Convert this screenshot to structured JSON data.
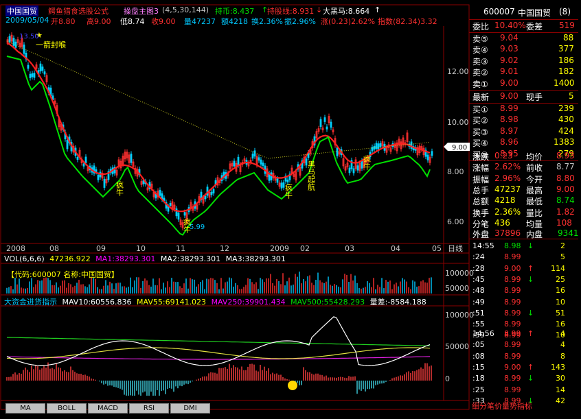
{
  "header": {
    "stock_name": "中国国贸",
    "formula_name": "鳄鱼猎食选股公式",
    "main_chart_label": "操盘主图3",
    "main_chart_params": "(4,5,30,144)",
    "hold_line": "持币:8.437",
    "hold_arrow": "↑",
    "stock_line": "持股线:8.931",
    "stock_arrow": "↓",
    "big_horse": "大黑马:8.664",
    "big_arrow": "↑"
  },
  "info": {
    "date": "2009/05/04",
    "open": "开8.80",
    "high": "高9.00",
    "low": "低8.74",
    "close": "收9.00",
    "volume": "量47237",
    "amount": "额4218",
    "turnover": "换2.36%",
    "amplitude": "振2.96%",
    "change": "涨(0.23)2.62%",
    "index": "指数(82.34)3.32"
  },
  "price_axis": [
    "12.00",
    "10.00",
    "8.00",
    "6.00"
  ],
  "current_price_tag": "9.00",
  "time_axis": [
    "2008",
    "08",
    "09",
    "10",
    "11",
    "12",
    "2009",
    "02",
    "03",
    "04",
    "05"
  ],
  "time_axis_right_label": "日线",
  "annotations": {
    "peak_label": "一箭封喉",
    "peak_price": "13.50",
    "low_price": "5.99",
    "crazy_cow_1": "疯牛",
    "crazy_cow_2": "疯牛",
    "crazy_cow_3": "疯牛",
    "crazy_cow_4": "疯牛",
    "dark_horse": "黑马起航"
  },
  "vol_panel": {
    "label": "VOL(6,6,6)",
    "value": "47236.922",
    "ma1": "MA1:38293.301",
    "ma2": "MA2:38293.301",
    "ma3": "MA3:38293.301",
    "code_label": "【代码:600007 名称:中国国贸】",
    "axis": [
      "100000",
      "50000"
    ]
  },
  "capital_panel": {
    "label": "大资金进货指示",
    "mav10": "MAV10:60556.836",
    "mav55": "MAV55:69141.023",
    "mav250": "MAV250:39901.434",
    "mav500": "MAV500:55428.293",
    "diff": "量差:-8584.188",
    "axis": [
      "100000",
      "50000",
      "0"
    ]
  },
  "tabs": [
    "MA",
    "BOLL",
    "MACD",
    "RSI",
    "DMI"
  ],
  "quote": {
    "code": "600007",
    "name": "中国国贸",
    "suffix": "(8)",
    "weibi_label": "委比",
    "weibi_value": "10.40%",
    "weicha_label": "委差",
    "weicha_value": "519",
    "asks": [
      {
        "label": "卖⑤",
        "price": "9.04",
        "vol": "88"
      },
      {
        "label": "卖④",
        "price": "9.03",
        "vol": "377"
      },
      {
        "label": "卖③",
        "price": "9.02",
        "vol": "186"
      },
      {
        "label": "卖②",
        "price": "9.01",
        "vol": "182"
      },
      {
        "label": "卖①",
        "price": "9.00",
        "vol": "1400"
      }
    ],
    "last_label": "最新",
    "last_value": "9.00",
    "hand_label": "现手",
    "hand_value": "5",
    "bids": [
      {
        "label": "买①",
        "price": "8.99",
        "vol": "239"
      },
      {
        "label": "买②",
        "price": "8.98",
        "vol": "430"
      },
      {
        "label": "买③",
        "price": "8.97",
        "vol": "424"
      },
      {
        "label": "买④",
        "price": "8.96",
        "vol": "1383"
      },
      {
        "label": "买⑤",
        "price": "8.95",
        "vol": "279"
      }
    ],
    "stats": [
      {
        "l1": "涨跌",
        "v1": "0.23",
        "l2": "均价",
        "v2": "8.93"
      },
      {
        "l1": "涨幅",
        "v1": "2.62%",
        "l2": "前收",
        "v2": "8.77"
      },
      {
        "l1": "振幅",
        "v1": "2.96%",
        "l2": "今开",
        "v2": "8.80"
      },
      {
        "l1": "总手",
        "v1": "47237",
        "l2": "最高",
        "v2": "9.00"
      },
      {
        "l1": "总额",
        "v1": "4218",
        "l2": "最低",
        "v2": "8.74"
      },
      {
        "l1": "换手",
        "v1": "2.36%",
        "l2": "量比",
        "v2": "1.82"
      },
      {
        "l1": "分笔",
        "v1": "436",
        "l2": "均量",
        "v2": "108"
      }
    ],
    "outer_label": "外盘",
    "outer_value": "37896",
    "inner_label": "内盘",
    "inner_value": "9341",
    "ticks_a": [
      {
        "t": "14:55",
        "p": "8.98",
        "d": "↓",
        "v": "2"
      },
      {
        "t": ":24",
        "p": "8.99",
        "d": "",
        "v": "5"
      },
      {
        "t": ":28",
        "p": "9.00",
        "d": "↑",
        "v": "114"
      },
      {
        "t": ":45",
        "p": "8.99",
        "d": "↓",
        "v": "25"
      },
      {
        "t": ":48",
        "p": "8.99",
        "d": "",
        "v": "16"
      },
      {
        "t": ":49",
        "p": "8.99",
        "d": "",
        "v": "10"
      },
      {
        "t": ":51",
        "p": "8.99",
        "d": "↓",
        "v": "51"
      },
      {
        "t": ":55",
        "p": "8.99",
        "d": "",
        "v": "16"
      },
      {
        "t": ":59",
        "p": "8.99",
        "d": "",
        "v": "10"
      }
    ],
    "ticks_b": [
      {
        "t": "14:56",
        "p": "8.99",
        "d": "↑",
        "v": "4"
      },
      {
        "t": ":05",
        "p": "8.99",
        "d": "",
        "v": "4"
      },
      {
        "t": ":08",
        "p": "8.99",
        "d": "",
        "v": "8"
      },
      {
        "t": ":15",
        "p": "9.00",
        "d": "↑",
        "v": "143"
      },
      {
        "t": ":18",
        "p": "8.99",
        "d": "↓",
        "v": "30"
      },
      {
        "t": ":25",
        "p": "8.99",
        "d": "",
        "v": "14"
      },
      {
        "t": ":33",
        "p": "8.99",
        "d": "↓",
        "v": "42"
      }
    ],
    "bottom_tabs": "细分笔价量势指标"
  },
  "colors": {
    "red": "#ff3030",
    "green": "#00e000",
    "yellow": "#ffff00",
    "cyan": "#00c8ff",
    "magenta": "#ff00ff",
    "grid": "#8b0000"
  }
}
